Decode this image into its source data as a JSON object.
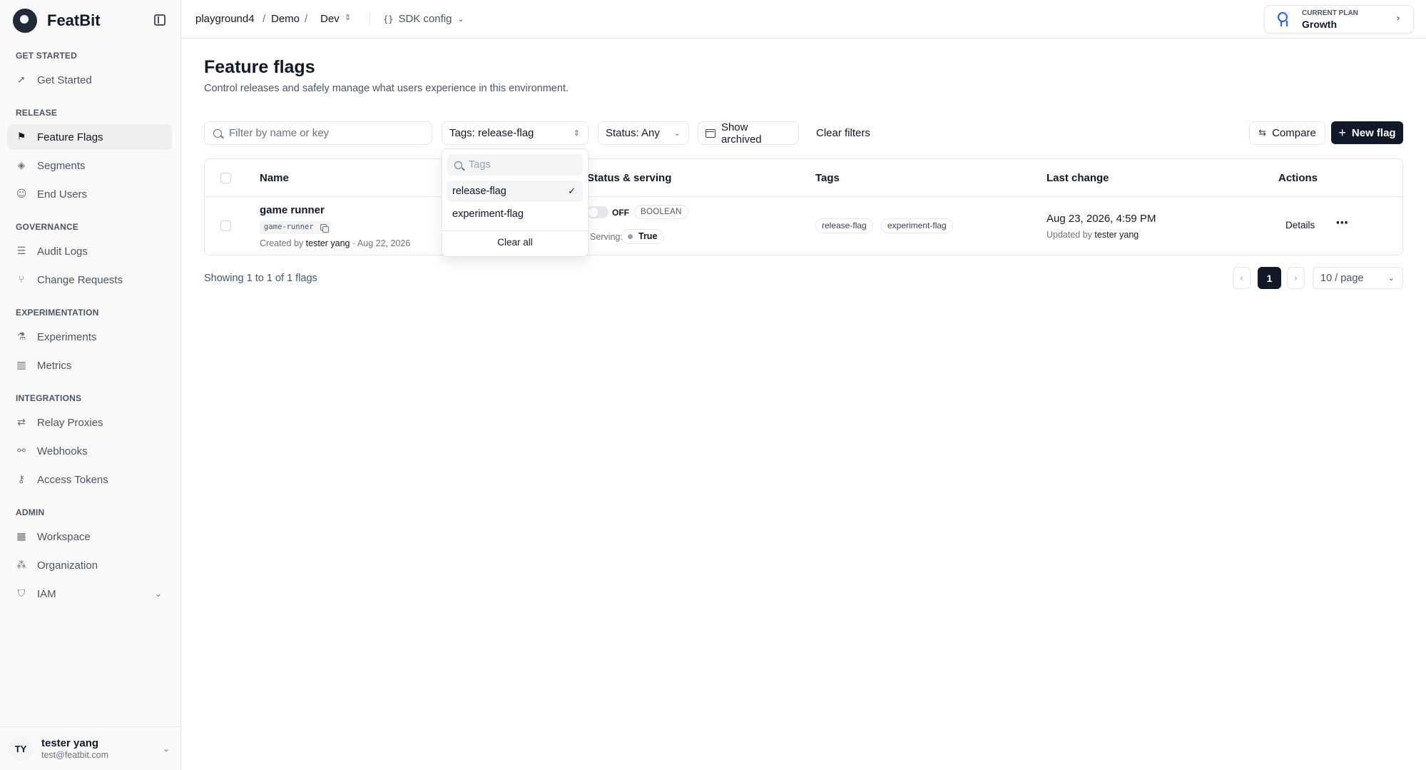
{
  "app": {
    "brand": "FeatBit"
  },
  "sidebar": {
    "sections": [
      {
        "title": "GET STARTED",
        "items": [
          {
            "label": "Get Started",
            "icon": "rocket-icon"
          }
        ]
      },
      {
        "title": "RELEASE",
        "items": [
          {
            "label": "Feature Flags",
            "icon": "flag-icon",
            "active": true
          },
          {
            "label": "Segments",
            "icon": "layers-icon"
          },
          {
            "label": "End Users",
            "icon": "user-icon"
          }
        ]
      },
      {
        "title": "GOVERNANCE",
        "items": [
          {
            "label": "Audit Logs",
            "icon": "list-icon"
          },
          {
            "label": "Change Requests",
            "icon": "git-pull-request-icon"
          }
        ]
      },
      {
        "title": "EXPERIMENTATION",
        "items": [
          {
            "label": "Experiments",
            "icon": "flask-icon"
          },
          {
            "label": "Metrics",
            "icon": "bar-chart-icon"
          }
        ]
      },
      {
        "title": "INTEGRATIONS",
        "items": [
          {
            "label": "Relay Proxies",
            "icon": "relay-icon"
          },
          {
            "label": "Webhooks",
            "icon": "webhook-icon"
          },
          {
            "label": "Access Tokens",
            "icon": "key-icon"
          }
        ]
      },
      {
        "title": "ADMIN",
        "items": [
          {
            "label": "Workspace",
            "icon": "building-icon"
          },
          {
            "label": "Organization",
            "icon": "organization-icon"
          },
          {
            "label": "IAM",
            "icon": "shield-icon"
          }
        ]
      }
    ],
    "user": {
      "initials": "TY",
      "name": "tester yang",
      "email": "test@featbit.com"
    }
  },
  "topbar": {
    "breadcrumb": {
      "project": "playground4",
      "sep1": "/",
      "environment_group": "Demo",
      "sep2": "/",
      "environment": "Dev"
    },
    "sdk_config": "SDK config",
    "plan": {
      "label": "CURRENT PLAN",
      "value": "Growth"
    }
  },
  "main": {
    "title": "Feature flags",
    "subtitle": "Control releases and safely manage what users experience in this environment.",
    "toolbar": {
      "search_placeholder": "Filter by name or key",
      "tags_filter": "Tags: release-flag",
      "status_filter": "Status: Any",
      "show_archived": "Show archived",
      "clear_filters": "Clear filters",
      "compare": "Compare",
      "new_flag": "New flag"
    },
    "table": {
      "columns": {
        "name": "Name",
        "status": "Status & serving",
        "tags": "Tags",
        "last_change": "Last change",
        "actions": "Actions"
      },
      "rows": [
        {
          "name": "game runner",
          "key": "game-runner",
          "created_by_label": "Created by",
          "created_by": "tester yang",
          "created_date": "· Aug 22, 2026",
          "status": "OFF",
          "type": "BOOLEAN",
          "serving_label": "Serving:",
          "serving_value": "True",
          "tags": [
            "release-flag",
            "experiment-flag"
          ],
          "last_change": "Aug 23, 2026, 4:59 PM",
          "updated_by_label": "Updated by",
          "updated_by": "tester yang",
          "details": "Details",
          "more": "···"
        }
      ]
    },
    "footer": {
      "showing": "Showing 1 to 1 of 1 flags",
      "current_page": "1",
      "page_size": "10 / page"
    }
  },
  "tags_dropdown": {
    "search_placeholder": "Tags",
    "options": [
      {
        "label": "release-flag",
        "selected": true
      },
      {
        "label": "experiment-flag",
        "selected": false
      }
    ],
    "clear_all": "Clear all"
  }
}
